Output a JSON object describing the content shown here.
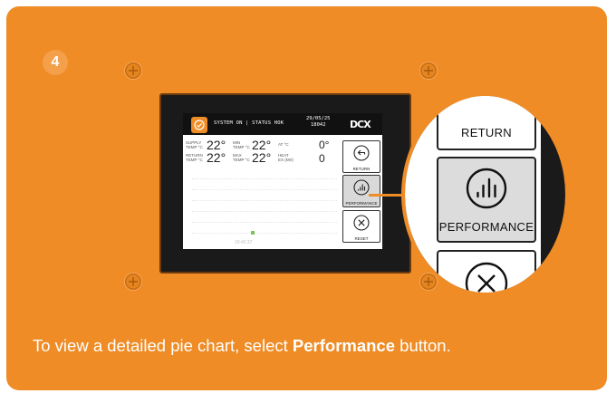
{
  "step_number": "4",
  "screen": {
    "status_text": "SYSTEM ON | STATUS HOK",
    "date": "29/05/25",
    "time": "18042",
    "brand": "DCX",
    "readings": {
      "supply": {
        "label1": "SUPPLY",
        "label2": "TEMP °C",
        "value": "22°"
      },
      "return": {
        "label1": "RETURN",
        "label2": "TEMP °C",
        "value": "22°"
      },
      "min": {
        "label1": "MIN",
        "label2": "TEMP °C",
        "value": "22°"
      },
      "max": {
        "label1": "MAX",
        "label2": "TEMP °C",
        "value": "22°"
      },
      "at": {
        "label1": "AT °C",
        "value": "0°"
      },
      "heat": {
        "label1": "HEAT",
        "label2": "EX (kW)",
        "value": "0"
      }
    },
    "graph_time": "10:42:37",
    "buttons": {
      "return": "RETURN",
      "performance": "PERFORMANCE",
      "reset": "RESET"
    }
  },
  "callout": {
    "return": "RETURN",
    "performance": "PERFORMANCE"
  },
  "caption": {
    "before": "To view a detailed pie chart, select ",
    "bold": "Performance",
    "after": " button."
  },
  "colors": {
    "card": "#ef8c26",
    "badge": "#f4a04a",
    "accent_green": "#7ac25a"
  }
}
